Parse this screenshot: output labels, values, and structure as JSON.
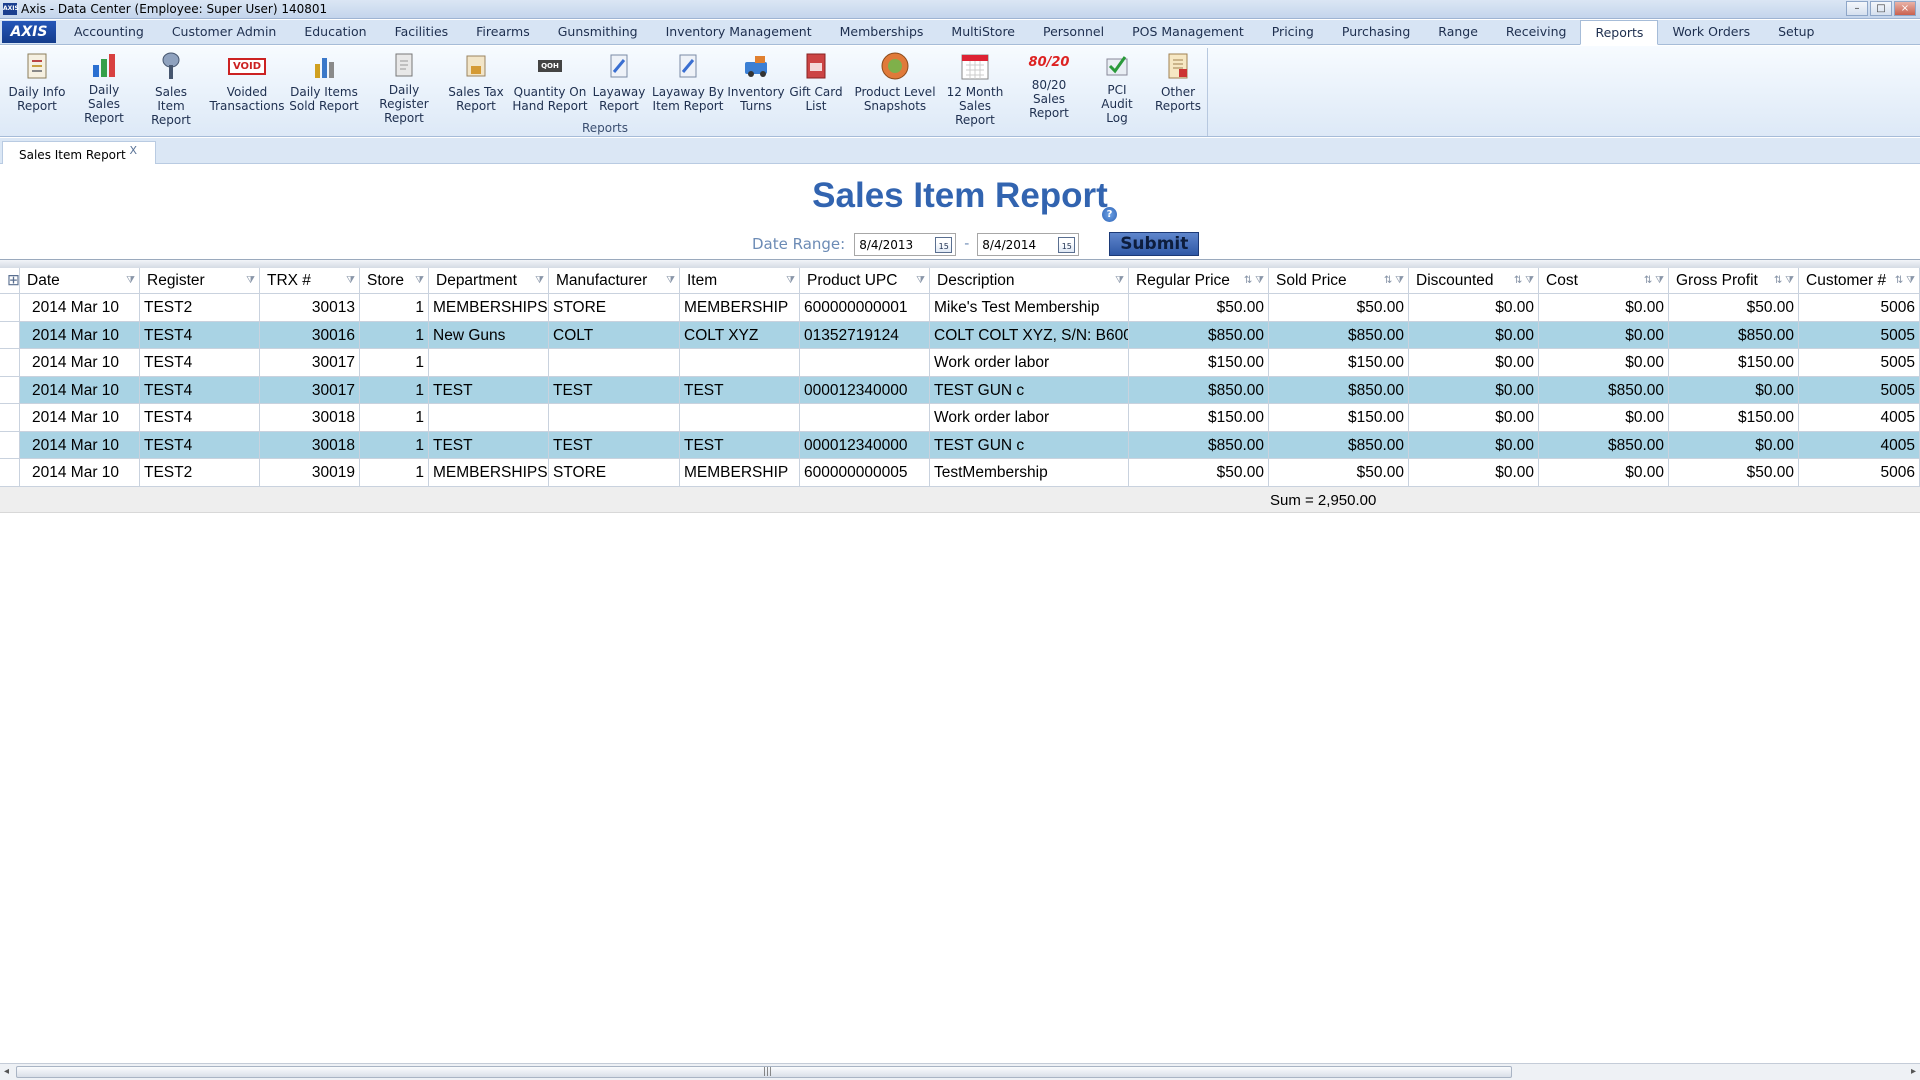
{
  "window": {
    "title": "Axis - Data Center  (Employee: Super User) 140801",
    "minimize": "–",
    "restore": "□",
    "close": "×"
  },
  "logo": "AXIS",
  "menu_tabs": [
    "Accounting",
    "Customer Admin",
    "Education",
    "Facilities",
    "Firearms",
    "Gunsmithing",
    "Inventory Management",
    "Memberships",
    "MultiStore",
    "Personnel",
    "POS Management",
    "Pricing",
    "Purchasing",
    "Range",
    "Receiving",
    "Reports",
    "Work Orders",
    "Setup"
  ],
  "active_menu_tab": "Reports",
  "ribbon": {
    "group_label": "Reports",
    "buttons": [
      {
        "label": "Daily Info\nReport",
        "icon": "daily-info-report-icon"
      },
      {
        "label": "Daily Sales\nReport",
        "icon": "daily-sales-report-icon"
      },
      {
        "label": "Sales Item\nReport",
        "icon": "sales-item-report-icon"
      },
      {
        "label": "Voided\nTransactions",
        "icon": "voided-transactions-icon",
        "icon_text": "VOID"
      },
      {
        "label": "Daily Items\nSold Report",
        "icon": "daily-items-sold-icon"
      },
      {
        "label": "Daily Register\nReport",
        "icon": "daily-register-report-icon"
      },
      {
        "label": "Sales Tax\nReport",
        "icon": "sales-tax-report-icon"
      },
      {
        "label": "Quantity On\nHand Report",
        "icon": "quantity-on-hand-icon",
        "icon_text": "QOH"
      },
      {
        "label": "Layaway\nReport",
        "icon": "layaway-report-icon"
      },
      {
        "label": "Layaway By\nItem Report",
        "icon": "layaway-by-item-icon"
      },
      {
        "label": "Inventory\nTurns",
        "icon": "inventory-turns-icon"
      },
      {
        "label": "Gift Card\nList",
        "icon": "gift-card-list-icon"
      },
      {
        "label": "Product Level\nSnapshots",
        "icon": "product-level-snapshots-icon"
      },
      {
        "label": "12 Month\nSales Report",
        "icon": "calendar-icon"
      },
      {
        "label": "80/20 Sales\nReport",
        "icon": "eighty-twenty-icon",
        "icon_text": "80/20"
      },
      {
        "label": "PCI Audit\nLog",
        "icon": "pci-audit-log-icon"
      },
      {
        "label": "Other\nReports",
        "icon": "other-reports-icon"
      }
    ]
  },
  "doc_tab": {
    "label": "Sales Item Report",
    "close": "X"
  },
  "report": {
    "title": "Sales Item Report",
    "help": "?",
    "date_range_label": "Date Range:",
    "start_date": "8/4/2013",
    "end_date": "8/4/2014",
    "calendar_glyph": "15",
    "dash": "-",
    "submit_label": "Submit"
  },
  "grid": {
    "columns": [
      "Date",
      "Register",
      "TRX #",
      "Store",
      "Department",
      "Manufacturer",
      "Item",
      "Product UPC",
      "Description",
      "Regular Price",
      "Sold Price",
      "Discounted",
      "Cost",
      "Gross Profit",
      "Customer #"
    ],
    "rows": [
      [
        "2014 Mar 10",
        "TEST2",
        "30013",
        "1",
        "MEMBERSHIPS",
        "STORE",
        "MEMBERSHIP",
        "600000000001",
        "Mike's Test Membership",
        "$50.00",
        "$50.00",
        "$0.00",
        "$0.00",
        "$50.00",
        "5006"
      ],
      [
        "2014 Mar 10",
        "TEST4",
        "30016",
        "1",
        "New Guns",
        "COLT",
        "COLT XYZ",
        "01352719124",
        "COLT COLT XYZ, S/N: B600",
        "$850.00",
        "$850.00",
        "$0.00",
        "$0.00",
        "$850.00",
        "5005"
      ],
      [
        "2014 Mar 10",
        "TEST4",
        "30017",
        "1",
        "",
        "",
        "",
        "",
        "Work order labor",
        "$150.00",
        "$150.00",
        "$0.00",
        "$0.00",
        "$150.00",
        "5005"
      ],
      [
        "2014 Mar 10",
        "TEST4",
        "30017",
        "1",
        "TEST",
        "TEST",
        "TEST",
        "000012340000",
        "TEST GUN c",
        "$850.00",
        "$850.00",
        "$0.00",
        "$850.00",
        "$0.00",
        "5005"
      ],
      [
        "2014 Mar 10",
        "TEST4",
        "30018",
        "1",
        "",
        "",
        "",
        "",
        "Work order labor",
        "$150.00",
        "$150.00",
        "$0.00",
        "$0.00",
        "$150.00",
        "4005"
      ],
      [
        "2014 Mar 10",
        "TEST4",
        "30018",
        "1",
        "TEST",
        "TEST",
        "TEST",
        "000012340000",
        "TEST GUN c",
        "$850.00",
        "$850.00",
        "$0.00",
        "$850.00",
        "$0.00",
        "4005"
      ],
      [
        "2014 Mar 10",
        "TEST2",
        "30019",
        "1",
        "MEMBERSHIPS",
        "STORE",
        "MEMBERSHIP",
        "600000000005",
        "TestMembership",
        "$50.00",
        "$50.00",
        "$0.00",
        "$0.00",
        "$50.00",
        "5006"
      ]
    ],
    "sum_label": "Sum = 2,950.00",
    "alt_row_color": "#a9d3e4"
  },
  "colors": {
    "title_blue": "#3264b0",
    "submit_blue": "#2f58a6"
  }
}
